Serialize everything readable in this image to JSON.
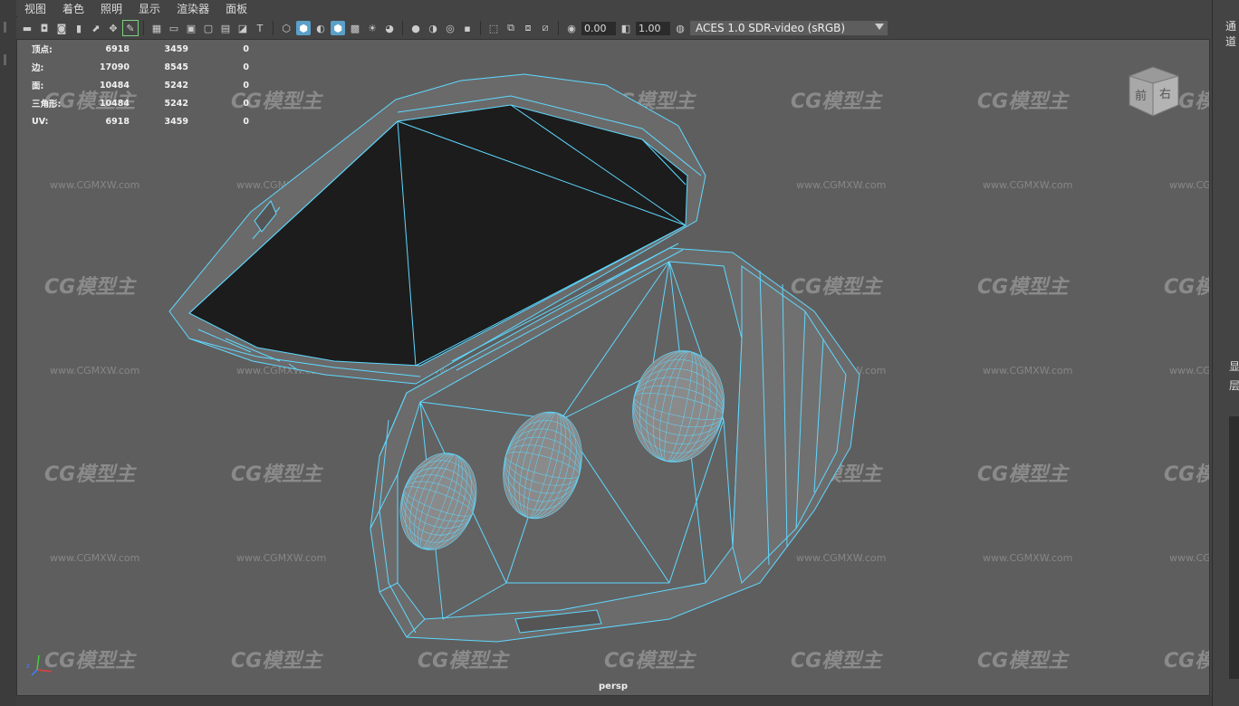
{
  "menu": [
    "视图",
    "着色",
    "照明",
    "显示",
    "渲染器",
    "面板"
  ],
  "toolbar": {
    "exposure_value": "0.00",
    "gamma_value": "1.00",
    "color_space": "ACES 1.0 SDR-video (sRGB)"
  },
  "hud": {
    "rows": [
      {
        "label": "顶点:",
        "c1": "6918",
        "c2": "3459",
        "c3": "0"
      },
      {
        "label": "边:",
        "c1": "17090",
        "c2": "8545",
        "c3": "0"
      },
      {
        "label": "面:",
        "c1": "10484",
        "c2": "5242",
        "c3": "0"
      },
      {
        "label": "三角形:",
        "c1": "10484",
        "c2": "5242",
        "c3": "0"
      },
      {
        "label": "UV:",
        "c1": "6918",
        "c2": "3459",
        "c3": "0"
      }
    ]
  },
  "viewport": {
    "camera_label": "persp",
    "viewcube_front": "前",
    "viewcube_right": "右"
  },
  "watermark": {
    "logo": "CG模型主",
    "url": "www.CGMXW.com"
  },
  "right_panel": {
    "tab": "通道",
    "label_1": "显",
    "label_2": "层"
  },
  "colors": {
    "wire": "#5fd8ff",
    "viewport_bg": "#5e5e5e",
    "interior": "#1c1c1c"
  }
}
